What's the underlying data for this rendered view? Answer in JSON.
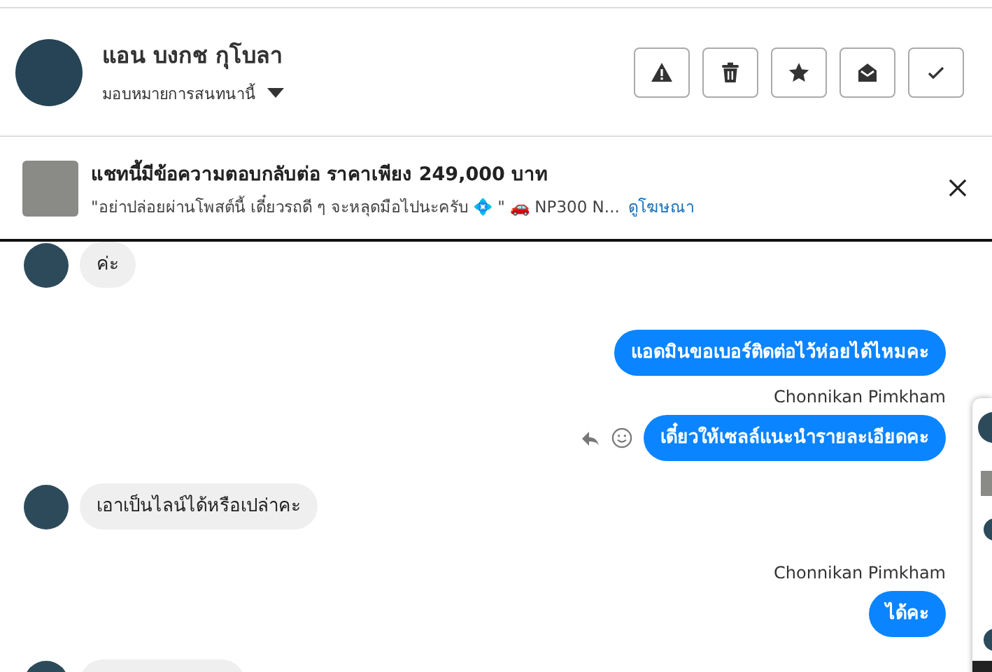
{
  "contact": {
    "name": "แอน บงกช กุโบลา",
    "assign_label": "มอบหมายการสนทนานี้"
  },
  "toolbar": [
    {
      "kind": "warning"
    },
    {
      "kind": "trash"
    },
    {
      "kind": "star"
    },
    {
      "kind": "mail"
    },
    {
      "kind": "check"
    }
  ],
  "ad": {
    "title": "แชทนี้มีข้อความตอบกลับต่อ ราคาเพียง 249,000 บาท",
    "snippet": "\"อย่าปล่อยผ่านโพสต์นี้ เดี๋ยวรถดี ๆ จะหลุดมือไปนะครับ 💠 \" 🚗 NP300 N...",
    "link": "ดูโฆษณา"
  },
  "messages": [
    {
      "kind": "incoming",
      "text": "ค่ะ"
    },
    {
      "kind": "outgoing",
      "text": "แอดมินขอเบอร์ติดต่อไว้ห่อยได้ไหมคะ"
    },
    {
      "kind": "outgoing",
      "sender": "Chonnikan Pimkham",
      "text": "เดี๋ยวให้เซลล์แนะนำรายละเอียดคะ",
      "actions": true
    },
    {
      "kind": "incoming",
      "text": "เอาเป็นไลน์ได้หรือเปล่าคะ"
    },
    {
      "kind": "outgoing",
      "sender": "Chonnikan Pimkham",
      "text": "ได้คะ"
    }
  ]
}
